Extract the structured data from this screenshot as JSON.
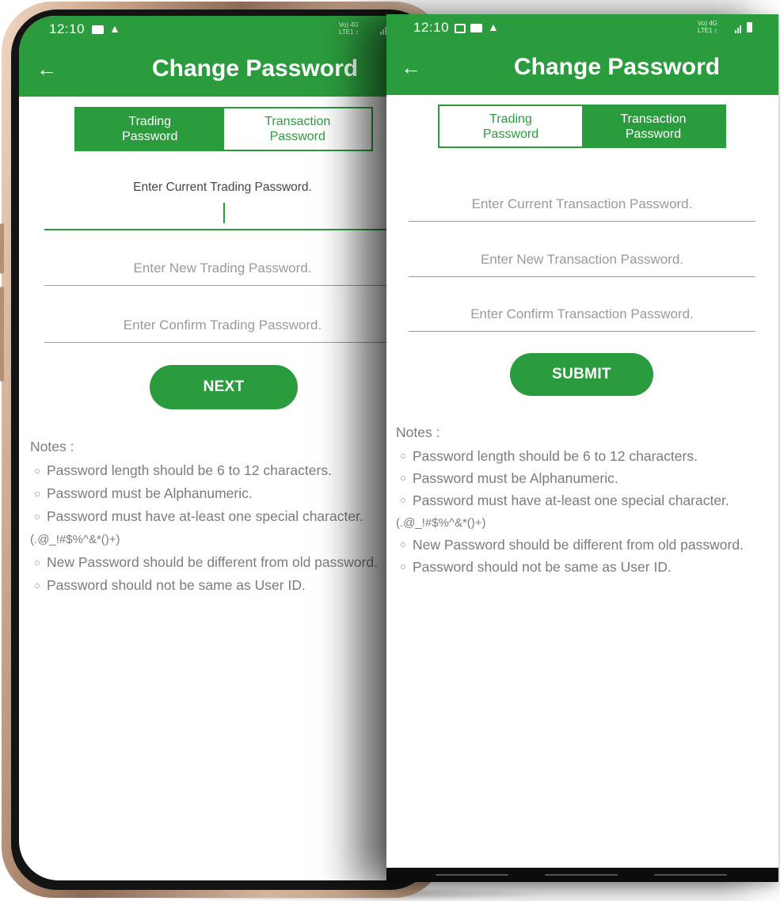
{
  "phone_left": {
    "status": {
      "time": "12:10",
      "network_text": "Vo) 4G\nLTE1 ↕"
    },
    "header": {
      "title": "Change Password"
    },
    "tabs": {
      "trading": "Trading\nPassword",
      "transaction": "Transaction\nPassword",
      "active": "trading"
    },
    "form": {
      "current_label": "Enter Current Trading Password.",
      "new_placeholder": "Enter New Trading Password.",
      "confirm_placeholder": "Enter Confirm Trading Password.",
      "button_label": "NEXT"
    },
    "notes": {
      "title": "Notes :",
      "items": [
        "Password length should be 6 to 12 characters.",
        "Password must be Alphanumeric.",
        "Password must have at-least one special character.",
        "New Password should be different from old password.",
        "Password should not be same as User ID."
      ],
      "special_chars": "(.@_!#$%^&*()+)"
    }
  },
  "phone_right": {
    "status": {
      "time": "12:10",
      "network_text": "Vo) 4G\nLTE1 ↕"
    },
    "header": {
      "title": "Change Password"
    },
    "tabs": {
      "trading": "Trading\nPassword",
      "transaction": "Transaction\nPassword",
      "active": "transaction"
    },
    "form": {
      "current_placeholder": "Enter Current Transaction Password.",
      "new_placeholder": "Enter New Transaction Password.",
      "confirm_placeholder": "Enter Confirm Transaction Password.",
      "button_label": "SUBMIT"
    },
    "notes": {
      "title": "Notes :",
      "items": [
        "Password length should be 6 to 12 characters.",
        "Password must be Alphanumeric.",
        "Password must have at-least one special character.",
        "New Password should be different from old password.",
        "Password should not be same as User ID."
      ],
      "special_chars": "(.@_!#$%^&*()+)"
    }
  },
  "theme": {
    "primary": "#2b9c3d",
    "text_muted": "#7c7c7c",
    "placeholder": "#9a9a9a"
  },
  "icons": [
    "back-arrow-icon",
    "youtube-icon",
    "warning-icon",
    "gallery-icon",
    "signal-icon",
    "battery-icon"
  ]
}
